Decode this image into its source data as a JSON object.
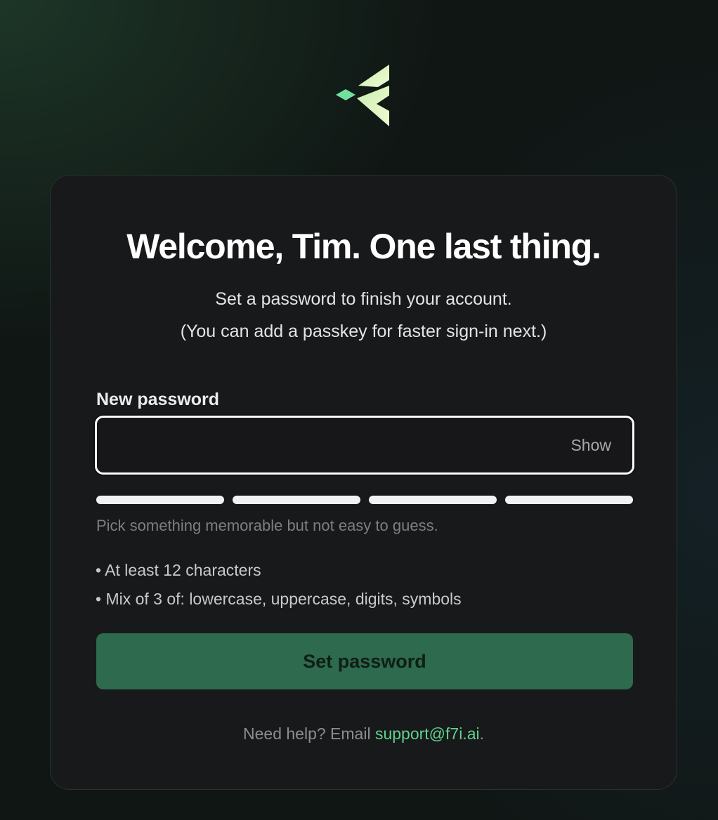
{
  "brand": {
    "logo_icon": "chevron-arrow-logo-icon",
    "colors": {
      "logo_light": "#eef7c9",
      "logo_green": "#6fe0a0"
    }
  },
  "card": {
    "title": "Welcome, Tim. One last thing.",
    "subtitle_line1": "Set a password to finish your account.",
    "subtitle_line2": "(You can add a passkey for faster sign-in next.)"
  },
  "password_field": {
    "label": "New password",
    "value": "",
    "placeholder": "",
    "show_label": "Show"
  },
  "strength_meter": {
    "segments": 4,
    "hint": "Pick something memorable but not easy to guess."
  },
  "requirements": [
    "• At least 12 characters",
    "• Mix of 3 of: lowercase, uppercase, digits, symbols"
  ],
  "submit": {
    "label": "Set password",
    "color": "#2e6a4d"
  },
  "help": {
    "prefix": "Need help? Email ",
    "email": "support@f7i.ai",
    "suffix": "."
  }
}
